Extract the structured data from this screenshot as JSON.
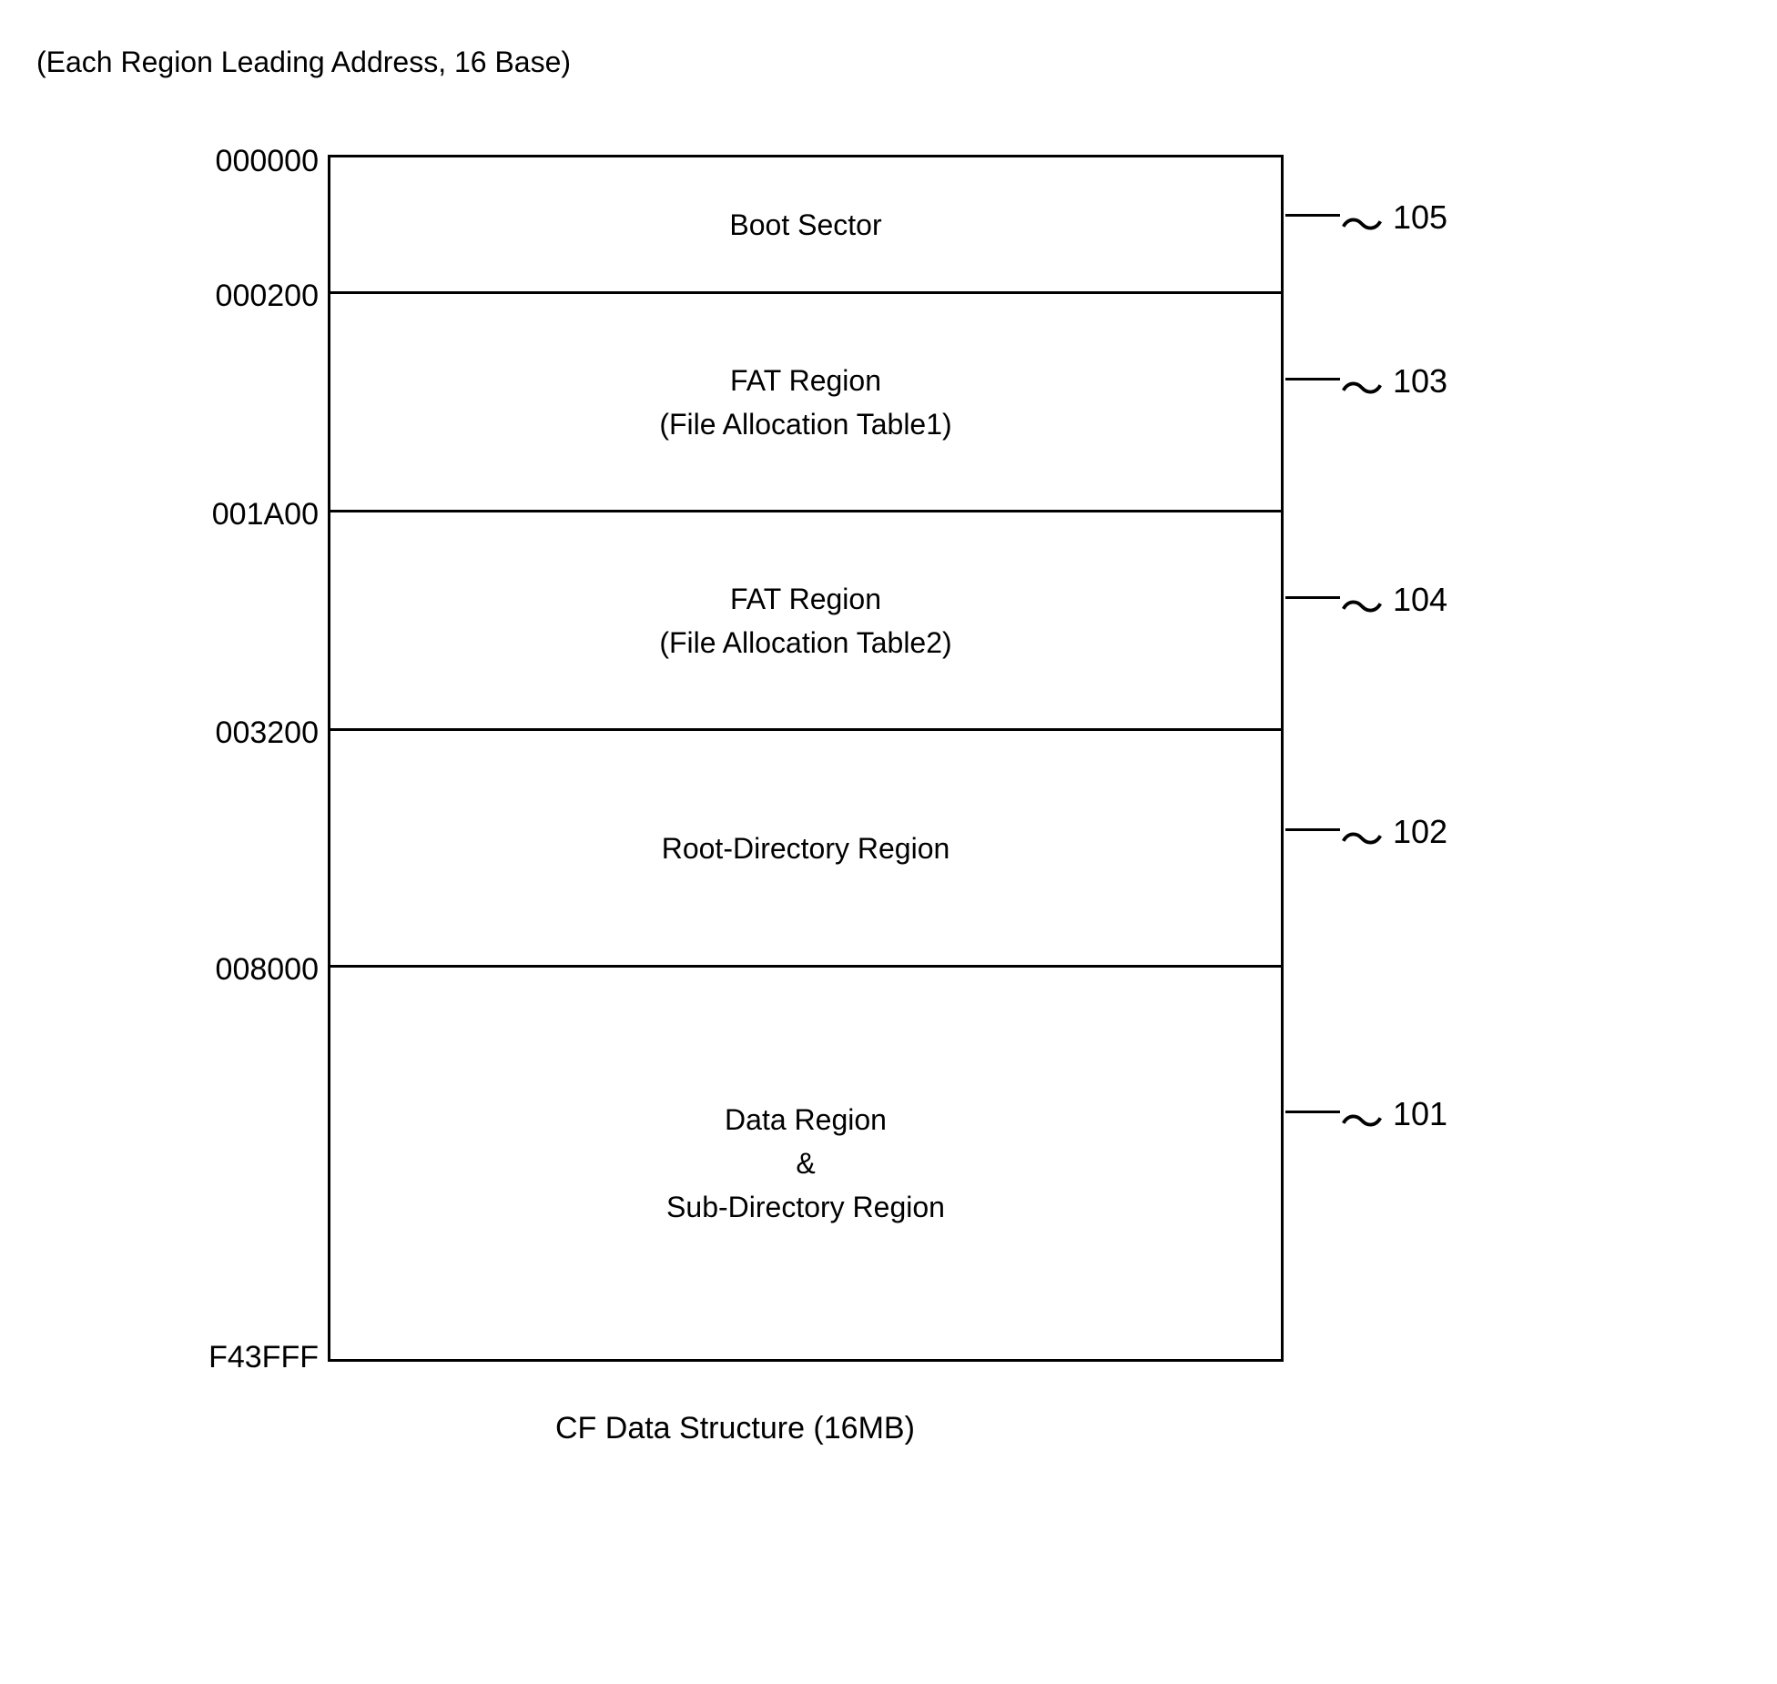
{
  "header": "(Each Region Leading Address, 16 Base)",
  "caption": "CF Data Structure (16MB)",
  "addresses": {
    "a0": "000000",
    "a1": "000200",
    "a2": "001A00",
    "a3": "003200",
    "a4": "008000",
    "a5": "F43FFF"
  },
  "regions": {
    "r105": {
      "line1": "Boot Sector",
      "ref": "105"
    },
    "r103": {
      "line1": "FAT Region",
      "line2": "(File Allocation Table1)",
      "ref": "103"
    },
    "r104": {
      "line1": "FAT Region",
      "line2": "(File Allocation Table2)",
      "ref": "104"
    },
    "r102": {
      "line1": "Root-Directory Region",
      "ref": "102"
    },
    "r101": {
      "line1": "Data Region",
      "line2": "&",
      "line3": "Sub-Directory Region",
      "ref": "101"
    }
  }
}
